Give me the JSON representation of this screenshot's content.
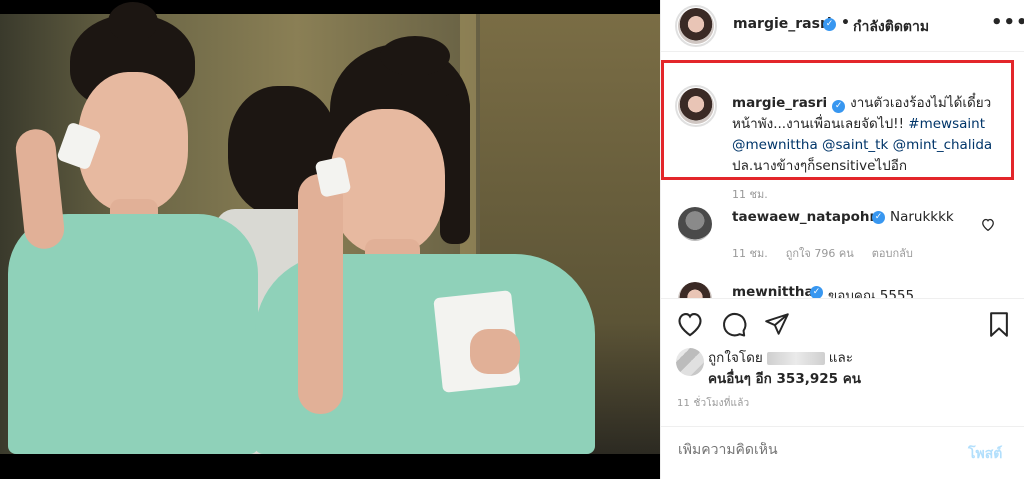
{
  "header": {
    "username": "margie_rasri",
    "separator": "•",
    "follow_label": "กำลังติดตาม",
    "more_label": "•••"
  },
  "caption": {
    "username": "margie_rasri",
    "line1": "งานตัวเองร้องไม่ได้เดี๋ยว",
    "line2_text": "หน้าพัง...งานเพื่อนเลยจัดไป!! ",
    "line2_tag": "#mewsaint",
    "line3_tags": "@mewnittha @saint_tk @mint_chalida",
    "line4": "ปล.นางข้างๆก็sensitiveไปอีก",
    "time": "11 ชม."
  },
  "comments": [
    {
      "username": "taewaew_natapohn",
      "text": "Narukkkk",
      "time": "11 ชม.",
      "likes": "ถูกใจ 796 คน",
      "reply": "ตอบกลับ"
    },
    {
      "username": "mewnittha",
      "text": "ขอบคุณ 5555"
    }
  ],
  "likes": {
    "prefix": "ถูกใจโดย",
    "and": "และ",
    "others": "คนอื่นๆ อีก 353,925 คน"
  },
  "post_time": "11 ชั่วโมงที่แล้ว",
  "add_comment": {
    "placeholder": "เพิ่มความคิดเห็น",
    "post_label": "โพสต์"
  },
  "colors": {
    "highlight_border": "#e3262a",
    "verified": "#3897f0",
    "hashtag": "#003569",
    "post_disabled": "#b2dffc"
  }
}
